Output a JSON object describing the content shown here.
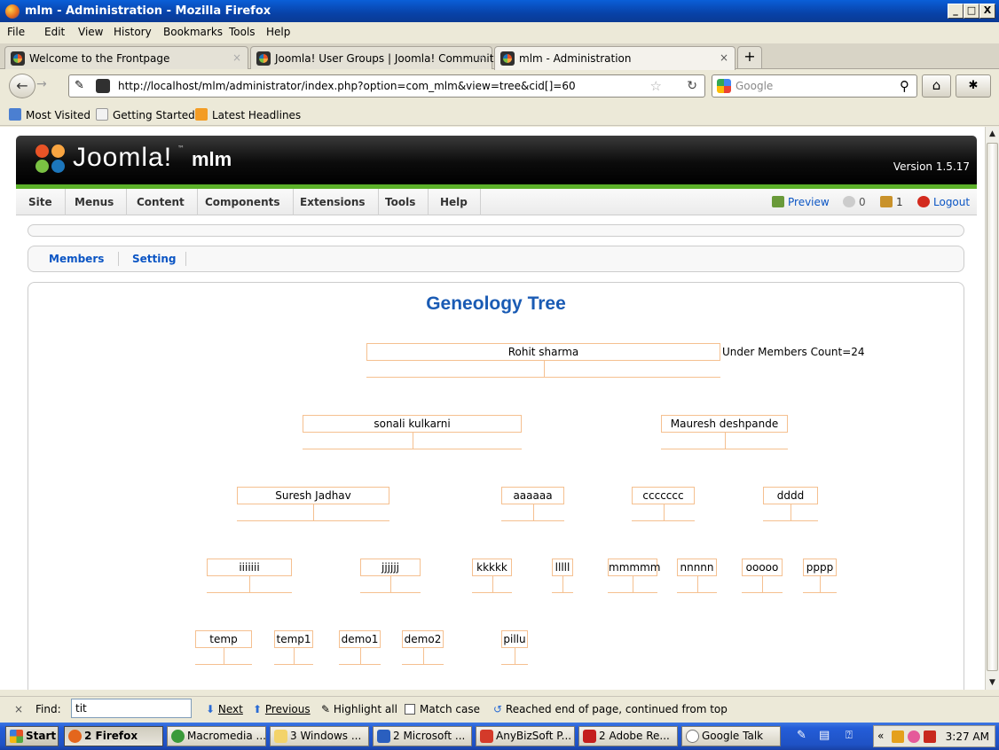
{
  "window": {
    "title": "mlm - Administration - Mozilla Firefox",
    "minimize": "_",
    "restore": "□",
    "close": "X"
  },
  "menu": [
    "File",
    "Edit",
    "View",
    "History",
    "Bookmarks",
    "Tools",
    "Help"
  ],
  "tabs": [
    {
      "label": "Welcome to the Frontpage",
      "close": "×"
    },
    {
      "label": "Joomla! User Groups | Joomla! Communit...",
      "close": "×"
    },
    {
      "label": "mlm - Administration",
      "close": "×"
    }
  ],
  "new_tab": "+",
  "nav": {
    "url": "http://localhost/mlm/administrator/index.php?option=com_mlm&view=tree&cid[]=60",
    "search_placeholder": "Google"
  },
  "bookmarks": [
    "Most Visited",
    "Getting Started",
    "Latest Headlines"
  ],
  "joomla": {
    "logo_text": "Joomla!",
    "trademark": "™",
    "site_name": "mlm",
    "version": "Version 1.5.17",
    "menu": [
      "Site",
      "Menus",
      "Content",
      "Components",
      "Extensions",
      "Tools",
      "Help"
    ],
    "status": {
      "preview": "Preview",
      "messages": "0",
      "users": "1",
      "logout": "Logout"
    },
    "submenu": [
      "Members",
      "Setting"
    ]
  },
  "tree": {
    "title": "Geneology Tree",
    "count_label": "Under Members Count=24",
    "nodes": {
      "root": "Rohit sharma",
      "l1a": "sonali kulkarni",
      "l1b": "Mauresh deshpande",
      "l2a": "Suresh Jadhav",
      "l2b": "aaaaaa",
      "l2c": "ccccccc",
      "l2d": "dddd",
      "l3a": "iiiiiii",
      "l3b": "jjjjjj",
      "l3c": "kkkkk",
      "l3d": "lllll",
      "l3e": "mmmmm",
      "l3f": "nnnnn",
      "l3g": "ooooo",
      "l3h": "pppp",
      "l4a": "temp",
      "l4b": "temp1",
      "l4c": "demo1",
      "l4d": "demo2",
      "l4e": "pillu"
    }
  },
  "findbar": {
    "close": "×",
    "label": "Find:",
    "value": "tit",
    "next": "Next",
    "previous": "Previous",
    "highlight": "Highlight all",
    "match_case": "Match case",
    "status": "Reached end of page, continued from top"
  },
  "taskbar": {
    "start": "Start",
    "items": [
      "2 Firefox",
      "Macromedia ...",
      "3 Windows ...",
      "2 Microsoft ...",
      "AnyBizSoft P...",
      "2 Adobe Re...",
      "Google Talk"
    ],
    "clock": "3:27 AM"
  }
}
